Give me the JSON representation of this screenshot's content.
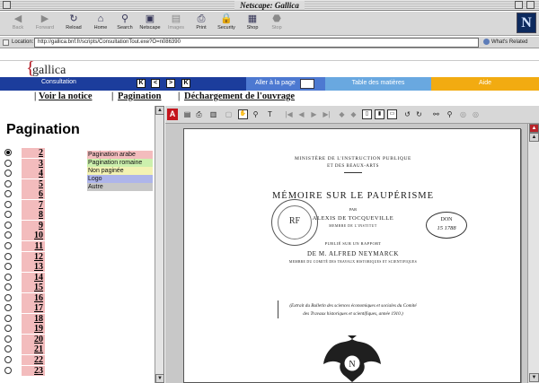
{
  "window": {
    "title": "Netscape: Gallica"
  },
  "toolbar": {
    "buttons": [
      {
        "label": "Back"
      },
      {
        "label": "Forward"
      },
      {
        "label": "Reload"
      },
      {
        "label": "Home"
      },
      {
        "label": "Search"
      },
      {
        "label": "Netscape"
      },
      {
        "label": "Images"
      },
      {
        "label": "Print"
      },
      {
        "label": "Security"
      },
      {
        "label": "Shop"
      },
      {
        "label": "Stop"
      }
    ],
    "logo": "N"
  },
  "location": {
    "label": "Location:",
    "url": "http://gallica.bnf.fr/scripts/ConsultationTout.exe?O=n086390",
    "related": "What's Related"
  },
  "gallica": {
    "logo_brace": "{",
    "logo_text": "gallica",
    "nav": {
      "consultation": "Consultation",
      "page_buttons": [
        "K",
        "<",
        ">",
        "K"
      ],
      "goto": "Aller à la page",
      "toc": "Table des matières",
      "aide": "Aide"
    },
    "links": {
      "notice": "Voir la notice",
      "pagination": "Pagination",
      "download": "Déchargement de l'ouvrage",
      "sep": "|"
    }
  },
  "left": {
    "title": "Pagination",
    "pages": [
      "2",
      "3",
      "4",
      "5",
      "6",
      "7",
      "8",
      "9",
      "10",
      "11",
      "12",
      "13",
      "14",
      "15",
      "16",
      "17",
      "18",
      "19",
      "20",
      "21",
      "22",
      "23"
    ],
    "legend": [
      {
        "label": "Pagination arabe",
        "color": "#f3bcbd"
      },
      {
        "label": "Pagination romaine",
        "color": "#ccf0ad"
      },
      {
        "label": "Non paginée",
        "color": "#f3f2b3"
      },
      {
        "label": "Logo",
        "color": "#aeb5ea"
      },
      {
        "label": "Autre",
        "color": "#c7c7c7"
      }
    ]
  },
  "document": {
    "line1": "MINISTÈRE DE L'INSTRUCTION PUBLIQUE",
    "line2": "ET DES BEAUX-ARTS",
    "title": "MÉMOIRE SUR LE PAUPÉRISME",
    "par": "PAR",
    "author": "ALEXIS DE TOCQUEVILLE",
    "author_sub": "MEMBRE DE L'INSTITUT",
    "pub": "PUBLIÉ SUR UN RAPPORT",
    "editor": "DE M. ALFRED NEYMARCK",
    "editor_sub": "MEMBRE DU COMITÉ DES TRAVAUX HISTORIQUES ET SCIENTIFIQUES",
    "extract1": "(Extrait du Bulletin des sciences économiques et sociales du Comité",
    "extract2": "des Travaux historiques et scientifiques, année 1910.)",
    "stamp_round": "RF",
    "stamp_oval_1": "DON",
    "stamp_oval_2": "15 1788"
  }
}
